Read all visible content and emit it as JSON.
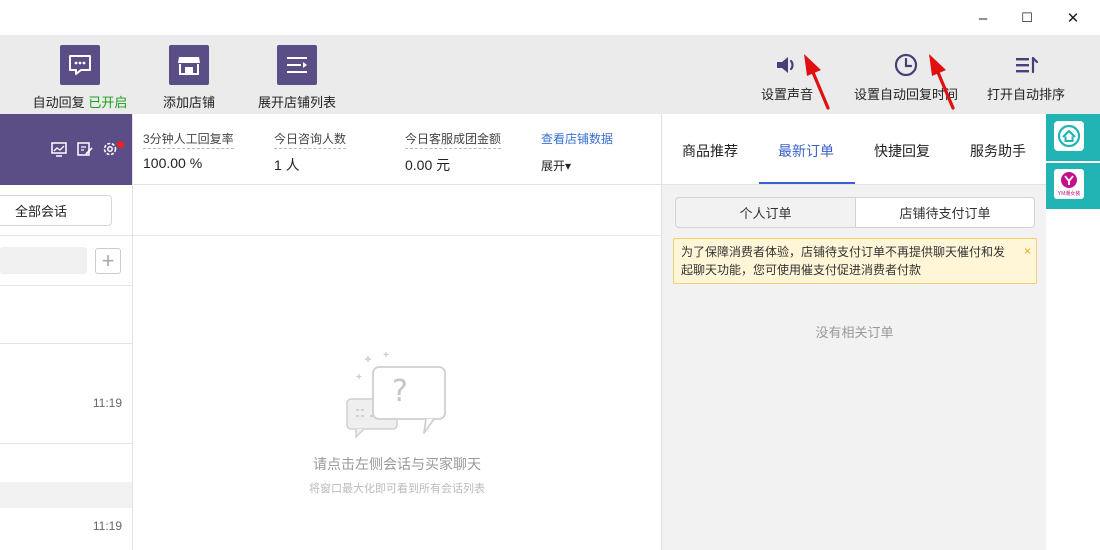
{
  "window": {
    "minimize_glyph": "–",
    "maximize_glyph": "☐",
    "close_glyph": "✕"
  },
  "toolbar": {
    "auto_reply_label": "自动回复",
    "auto_reply_status": "已开启",
    "add_shop_label": "添加店铺",
    "expand_shop_list_label": "展开店铺列表",
    "set_sound_label": "设置声音",
    "set_auto_reply_time_label": "设置自动回复时间",
    "auto_sort_label": "打开自动排序"
  },
  "left_panel": {
    "all_sessions_label": "全部会话",
    "add_symbol": "+",
    "times": [
      "11:19",
      "11:19"
    ]
  },
  "stats": {
    "reply_rate_label": "3分钟人工回复率",
    "reply_rate_value": "100.00 %",
    "consult_count_label": "今日咨询人数",
    "consult_count_value": "1 人",
    "deal_amount_label": "今日客服成团金额",
    "deal_amount_value": "0.00 元",
    "view_data_link": "查看店铺数据",
    "expand_label": "展开▾"
  },
  "chat": {
    "empty_title": "请点击左侧会话与买家聊天",
    "empty_hint": "将窗口最大化即可看到所有会话列表",
    "bubble_glyph": "?"
  },
  "right_panel": {
    "tabs": [
      "商品推荐",
      "最新订单",
      "快捷回复",
      "服务助手"
    ],
    "active_tab": "最新订单",
    "segments": [
      "个人订单",
      "店铺待支付订单"
    ],
    "active_segment": "店铺待支付订单",
    "notice_text": "为了保障消费者体验，店铺待支付订单不再提供聊天催付和发起聊天功能，您可使用催支付促进消费者付款",
    "notice_close": "×",
    "empty_text": "没有相关订单"
  },
  "strip": {
    "logo_text": "YM潮女装"
  },
  "colors": {
    "brand_purple": "#5b4d86",
    "active_blue": "#3a62c8",
    "link_blue": "#3670d0",
    "status_green": "#1aa01a",
    "notice_bg": "#fff6d8",
    "strip_teal": "#22b4b4",
    "annotation_red": "#e01010"
  }
}
